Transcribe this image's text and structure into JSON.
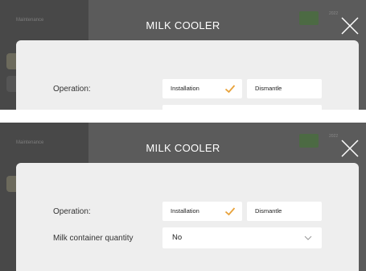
{
  "frames": [
    {
      "sidebar_label": "Maintenance",
      "title": "MILK COOLER",
      "top_right_tiny": "2022",
      "operation_label": "Operation:",
      "options": [
        {
          "label": "Installation",
          "selected": true
        },
        {
          "label": "Dismantle",
          "selected": false
        }
      ]
    },
    {
      "sidebar_label": "Maintenance",
      "title": "MILK COOLER",
      "top_right_tiny": "2022",
      "operation_label": "Operation:",
      "options": [
        {
          "label": "Installation",
          "selected": true
        },
        {
          "label": "Dismantle",
          "selected": false
        }
      ],
      "container_label": "Milk container quantity",
      "container_value": "No"
    }
  ],
  "colors": {
    "backdrop": "#5b5b5b",
    "panel": "#eeeeee",
    "check": "#e8a23a",
    "accent_green": "#4c6a43"
  }
}
